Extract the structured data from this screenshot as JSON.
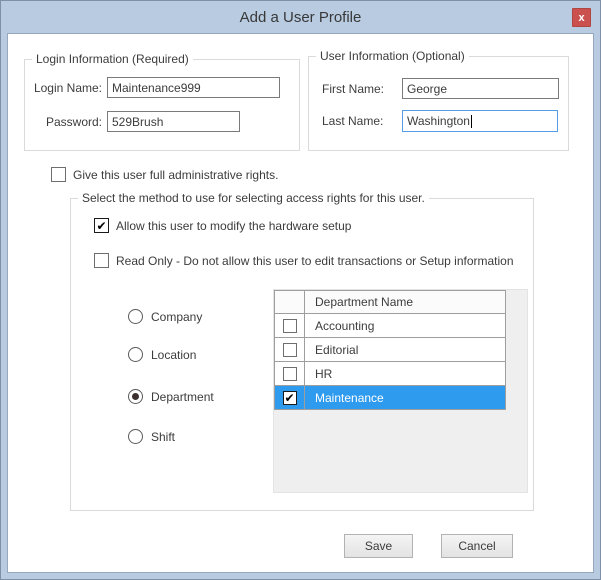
{
  "window": {
    "title": "Add a User Profile",
    "close_glyph": "x"
  },
  "icons": {
    "check": "✔"
  },
  "colors": {
    "titlebar_frame": "#b9cbe1",
    "close_button": "#ca514e",
    "selected_row": "#2f9bef",
    "focused_input_border": "#569de5"
  },
  "login_group": {
    "title": "Login Information (Required)",
    "login_name": {
      "label": "Login Name:",
      "value": "Maintenance999"
    },
    "password": {
      "label": "Password:",
      "value": "529Brush"
    }
  },
  "user_group": {
    "title": "User Information (Optional)",
    "first_name": {
      "label": "First Name:",
      "value": "George"
    },
    "last_name": {
      "label": "Last Name:",
      "value": "Washington",
      "focused": true
    }
  },
  "admin_checkbox": {
    "label": "Give this user full administrative rights.",
    "checked": false
  },
  "access_group": {
    "title": "Select the method to use for selecting access rights for this user.",
    "hardware_checkbox": {
      "label": "Allow this user to modify the hardware setup",
      "checked": true
    },
    "readonly_checkbox": {
      "label": "Read Only - Do not allow this user to edit transactions or Setup information",
      "checked": false
    },
    "radios": [
      {
        "label": "Company",
        "selected": false
      },
      {
        "label": "Location",
        "selected": false
      },
      {
        "label": "Department",
        "selected": true
      },
      {
        "label": "Shift",
        "selected": false
      }
    ],
    "table": {
      "header": "Department Name",
      "rows": [
        {
          "name": "Accounting",
          "checked": false,
          "selected": false
        },
        {
          "name": "Editorial",
          "checked": false,
          "selected": false
        },
        {
          "name": "HR",
          "checked": false,
          "selected": false
        },
        {
          "name": "Maintenance",
          "checked": true,
          "selected": true
        }
      ]
    }
  },
  "buttons": {
    "save": "Save",
    "cancel": "Cancel"
  }
}
